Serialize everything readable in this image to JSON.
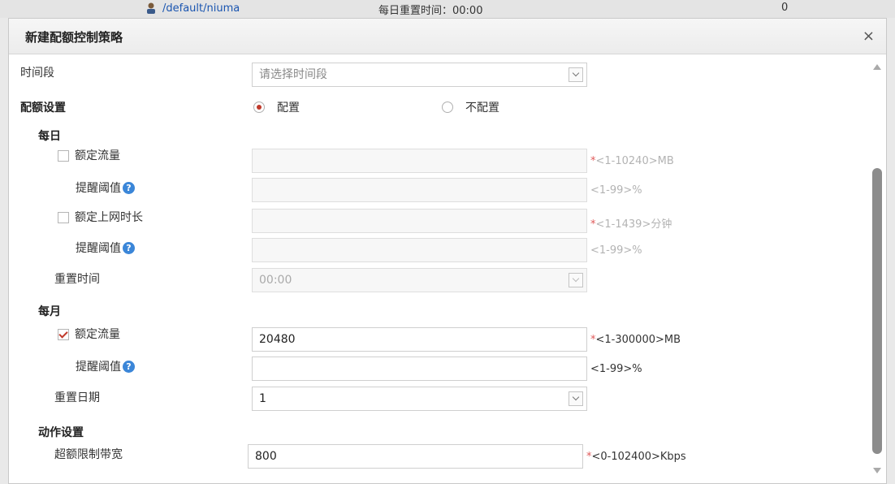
{
  "background_row": {
    "user_path": "/default/niuma",
    "reset_time_text": "每日重置时间：00:00",
    "count": "0"
  },
  "dialog": {
    "title": "新建配额控制策略",
    "close_glyph": "×"
  },
  "form": {
    "time_period": {
      "label": "时间段",
      "placeholder": "请选择时间段"
    },
    "quota_settings": {
      "label": "配额设置",
      "option_on": "配置",
      "option_off": "不配置",
      "selected": "配置"
    },
    "daily": {
      "label": "每日",
      "traffic": {
        "label": "额定流量",
        "checked": false,
        "value": "",
        "hint_star": "*",
        "hint": "<1-10240>MB"
      },
      "traffic_threshold": {
        "label": "提醒阈值",
        "value": "",
        "hint": "<1-99>%"
      },
      "online_time": {
        "label": "额定上网时长",
        "checked": false,
        "value": "",
        "hint_star": "*",
        "hint": "<1-1439>分钟"
      },
      "online_threshold": {
        "label": "提醒阈值",
        "value": "",
        "hint": "<1-99>%"
      },
      "reset_time": {
        "label": "重置时间",
        "value": "00:00"
      }
    },
    "monthly": {
      "label": "每月",
      "traffic": {
        "label": "额定流量",
        "checked": true,
        "value": "20480",
        "hint_star": "*",
        "hint": "<1-300000>MB"
      },
      "traffic_threshold": {
        "label": "提醒阈值",
        "value": "",
        "hint": "<1-99>%"
      },
      "reset_date": {
        "label": "重置日期",
        "value": "1"
      }
    },
    "action": {
      "label": "动作设置",
      "bandwidth_limit": {
        "label": "超额限制带宽",
        "value": "800",
        "hint_star": "*",
        "hint": "<0-102400>Kbps"
      }
    },
    "help_glyph": "?"
  },
  "colors": {
    "link": "#1a55b0",
    "required_star": "#e05a5a",
    "check_red": "#c0392b",
    "help_blue": "#3b86d8"
  }
}
